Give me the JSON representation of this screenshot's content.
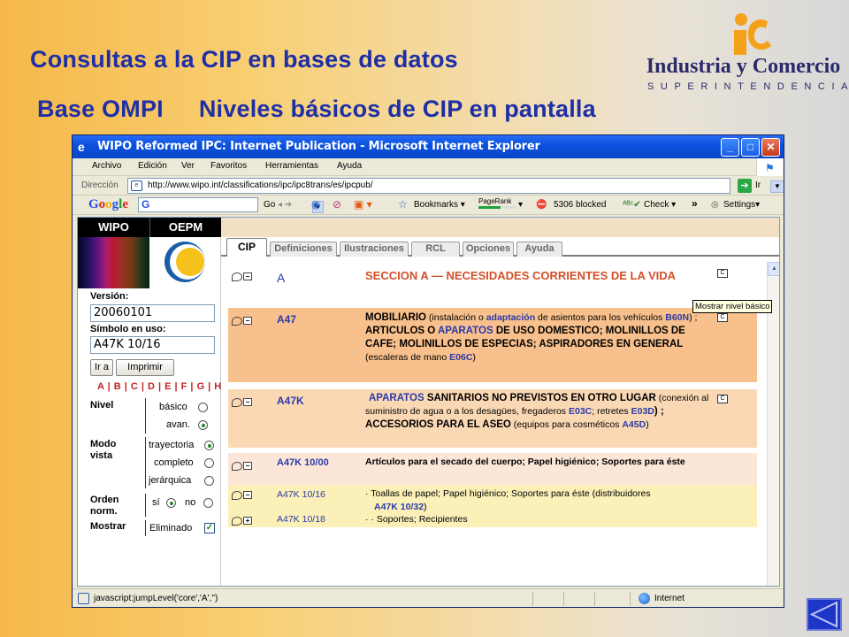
{
  "slide": {
    "title_line1": "Consultas a  la CIP en bases de datos",
    "title_line2_a": "Base  OMPI",
    "title_line2_b": "Niveles básicos de CIP en pantalla"
  },
  "logo": {
    "name": "Industria y Comercio",
    "sub": "SUPERINTENDENCIA",
    "colors": {
      "mark": "#f4a11a",
      "text": "#2a2a6a"
    }
  },
  "browser": {
    "title": "WIPO Reformed IPC: Internet Publication - Microsoft Internet Explorer",
    "menu": [
      "Archivo",
      "Edición",
      "Ver",
      "Favoritos",
      "Herramientas",
      "Ayuda"
    ],
    "address_label": "Dirección",
    "url": "http://www.wipo.int/classifications/ipc/ipc8trans/es/ipcpub/",
    "go_label": "Ir",
    "toolbar": {
      "google_go": "Go",
      "bookmarks": "Bookmarks",
      "pagerank": "PageRank",
      "blocked": "5306 blocked",
      "check": "Check",
      "more": "»",
      "settings": "Settings"
    },
    "status_text": "javascript:jumpLevel('core','A','')",
    "zone": "Internet",
    "colors": {
      "titlebar": "#0a52e0",
      "chrome": "#ece9d8"
    }
  },
  "left_panel": {
    "wipo": "WIPO",
    "oepm": "OEPM",
    "version_label": "Versión:",
    "version_value": "20060101",
    "symbol_label": "Símbolo en uso:",
    "symbol_value": "A47K 10/16",
    "go_button": "Ir a",
    "print_button": "Imprimir",
    "letters": "A | B | C | D | E | F | G | H",
    "nivel": {
      "label": "Nivel",
      "basic": "básico",
      "advanced": "avan."
    },
    "modo": {
      "label_1": "Modo",
      "label_2": "vista",
      "opt1": "trayectoria",
      "opt2": "completo",
      "opt3": "jerárquica"
    },
    "orden": {
      "label_1": "Orden",
      "label_2": "norm.",
      "yes": "sí",
      "no": "no"
    },
    "mostrar": {
      "label": "Mostrar",
      "option": "Eliminado"
    }
  },
  "tabs": [
    "CIP",
    "Definiciones",
    "Ilustraciones",
    "RCL",
    "Opciones",
    "Ayuda"
  ],
  "entries": {
    "section": {
      "code": "A",
      "text": "SECCION A — NECESIDADES CORRIENTES DE LA VIDA"
    },
    "class": {
      "code": "A47",
      "t1": "MOBILIARIO",
      "t2": " (instalación o ",
      "t3": "adaptación",
      "t4": " de asientos para los vehículos ",
      "t5": "B60N",
      "t6": ") ; ",
      "t7": "ARTICULOS O ",
      "t8": "APARATOS",
      "t9": " DE USO DOMESTICO",
      "t10": "; MOLINILLOS DE CAFE; MOLINILLOS DE ESPECIAS",
      "t11": "; ASPIRADORES EN GENERAL",
      "t12": " (escaleras de mano ",
      "t13": "E06C",
      "t14": ")"
    },
    "subclass": {
      "code": "A47K",
      "t1": "APARATOS",
      "t2": " SANITARIOS NO PREVISTOS EN OTRO LUGAR",
      "t3": " (conexión al suministro de agua o a los desagües, fregaderos ",
      "t4": "E03C",
      "t5": "; retretes ",
      "t6": "E03D",
      "t7": ") ; ACCESORIOS PARA EL ASEO",
      "t8": " (equipos para cosméticos ",
      "t9": "A45D",
      "t10": ")"
    },
    "group": {
      "code": "A47K 10/00",
      "text": "Artículos para el secado del cuerpo; Papel higiénico; Soportes para éste"
    },
    "sub1": {
      "code": "A47K 10/16",
      "bullet": "·",
      "text": "Toallas de papel; Papel higiénico; Soportes para éste (distribuidores ",
      "ref": "A47K 10/32",
      "end": ")"
    },
    "sub2": {
      "code": "A47K 10/18",
      "bullet": "· ·",
      "text": "Soportes; Recipientes"
    }
  },
  "tooltip": "Mostrar nivel básico"
}
